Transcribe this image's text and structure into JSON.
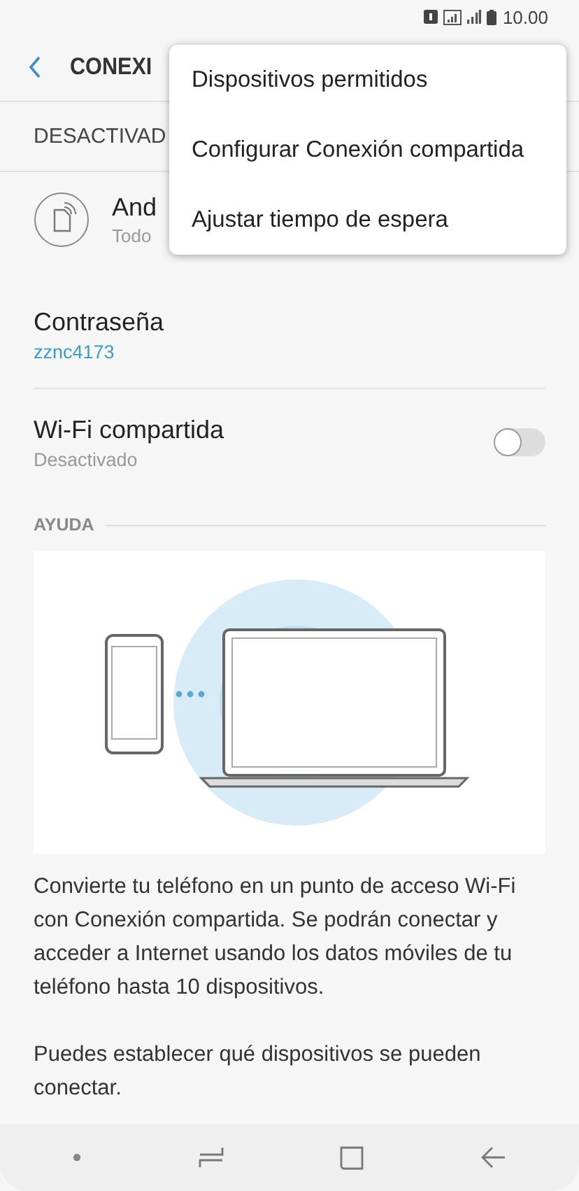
{
  "status_bar": {
    "time": "10.00"
  },
  "header": {
    "title": "CONEXI"
  },
  "status_label": "DESACTIVAD",
  "network": {
    "name": "And",
    "subtitle": "Todo"
  },
  "settings": [
    {
      "kind": "value",
      "label": "Contraseña",
      "value": "zznc4173"
    },
    {
      "kind": "switch",
      "label": "Wi-Fi compartida",
      "value": "Desactivado",
      "on": false
    }
  ],
  "help": {
    "heading": "AYUDA",
    "paragraphs": [
      "Convierte tu teléfono en un punto de acceso Wi-Fi con Conexión compartida. Se podrán conectar y acceder a Internet usando los datos móviles de tu teléfono hasta 10 dispositivos.",
      "Puedes establecer qué dispositivos se pueden conectar."
    ]
  },
  "menu": {
    "items": [
      "Dispositivos permitidos",
      "Configurar Conexión compartida",
      "Ajustar tiempo de espera"
    ]
  }
}
